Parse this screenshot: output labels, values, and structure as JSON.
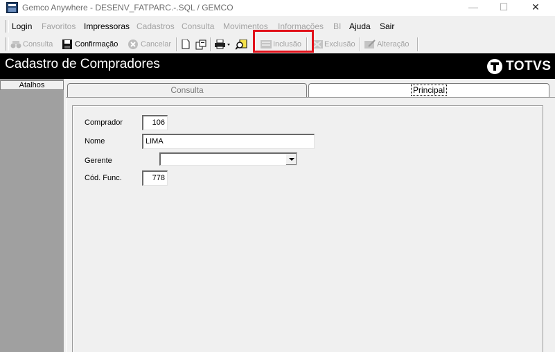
{
  "window": {
    "title": "Gemco Anywhere - DESENV_FATPARC.-.SQL / GEMCO",
    "minimize_glyph": "—",
    "maximize_glyph": "☐",
    "close_glyph": "✕"
  },
  "menu": {
    "items": [
      {
        "label": "Login",
        "enabled": true
      },
      {
        "label": "Favoritos",
        "enabled": false
      },
      {
        "label": "Impressoras",
        "enabled": true
      },
      {
        "label": "Cadastros",
        "enabled": false
      },
      {
        "label": "Consulta",
        "enabled": false
      },
      {
        "label": "Movimentos",
        "enabled": false
      },
      {
        "label": "Informações",
        "enabled": false
      },
      {
        "label": "BI",
        "enabled": false
      },
      {
        "label": "Ajuda",
        "enabled": true
      },
      {
        "label": "Sair",
        "enabled": true
      }
    ]
  },
  "toolbar": {
    "consulta": {
      "label": "Consulta",
      "icon": "binoculars-icon",
      "enabled": false
    },
    "confirmacao": {
      "label": "Confirmação",
      "icon": "floppy-disk-icon",
      "enabled": true
    },
    "cancelar": {
      "label": "Cancelar",
      "icon": "cancel-icon",
      "enabled": false
    },
    "new_doc_icon": "new-document-icon",
    "copy_icon": "copy-document-icon",
    "print_icon": "printer-icon",
    "search_icon": "magnify-icon",
    "inclusao": {
      "label": "Inclusão",
      "icon": "insert-record-icon",
      "enabled": false
    },
    "exclusao": {
      "label": "Exclusão",
      "icon": "delete-record-icon",
      "enabled": false
    },
    "alteracao": {
      "label": "Alteração",
      "icon": "edit-record-icon",
      "enabled": false
    },
    "highlight_color": "#e1121b"
  },
  "header": {
    "title": "Cadastro de Compradores",
    "brand": "TOTVS"
  },
  "sidebar": {
    "tab_label": "Atalhos"
  },
  "tabs": [
    {
      "label": "Consulta",
      "active": false
    },
    {
      "label": "Principal",
      "active": true
    }
  ],
  "form": {
    "comprador": {
      "label": "Comprador",
      "value": "106"
    },
    "nome": {
      "label": "Nome",
      "value": "LIMA"
    },
    "gerente": {
      "label": "Gerente",
      "value": ""
    },
    "cod_func": {
      "label": "Cód. Func.",
      "value": "778"
    }
  }
}
